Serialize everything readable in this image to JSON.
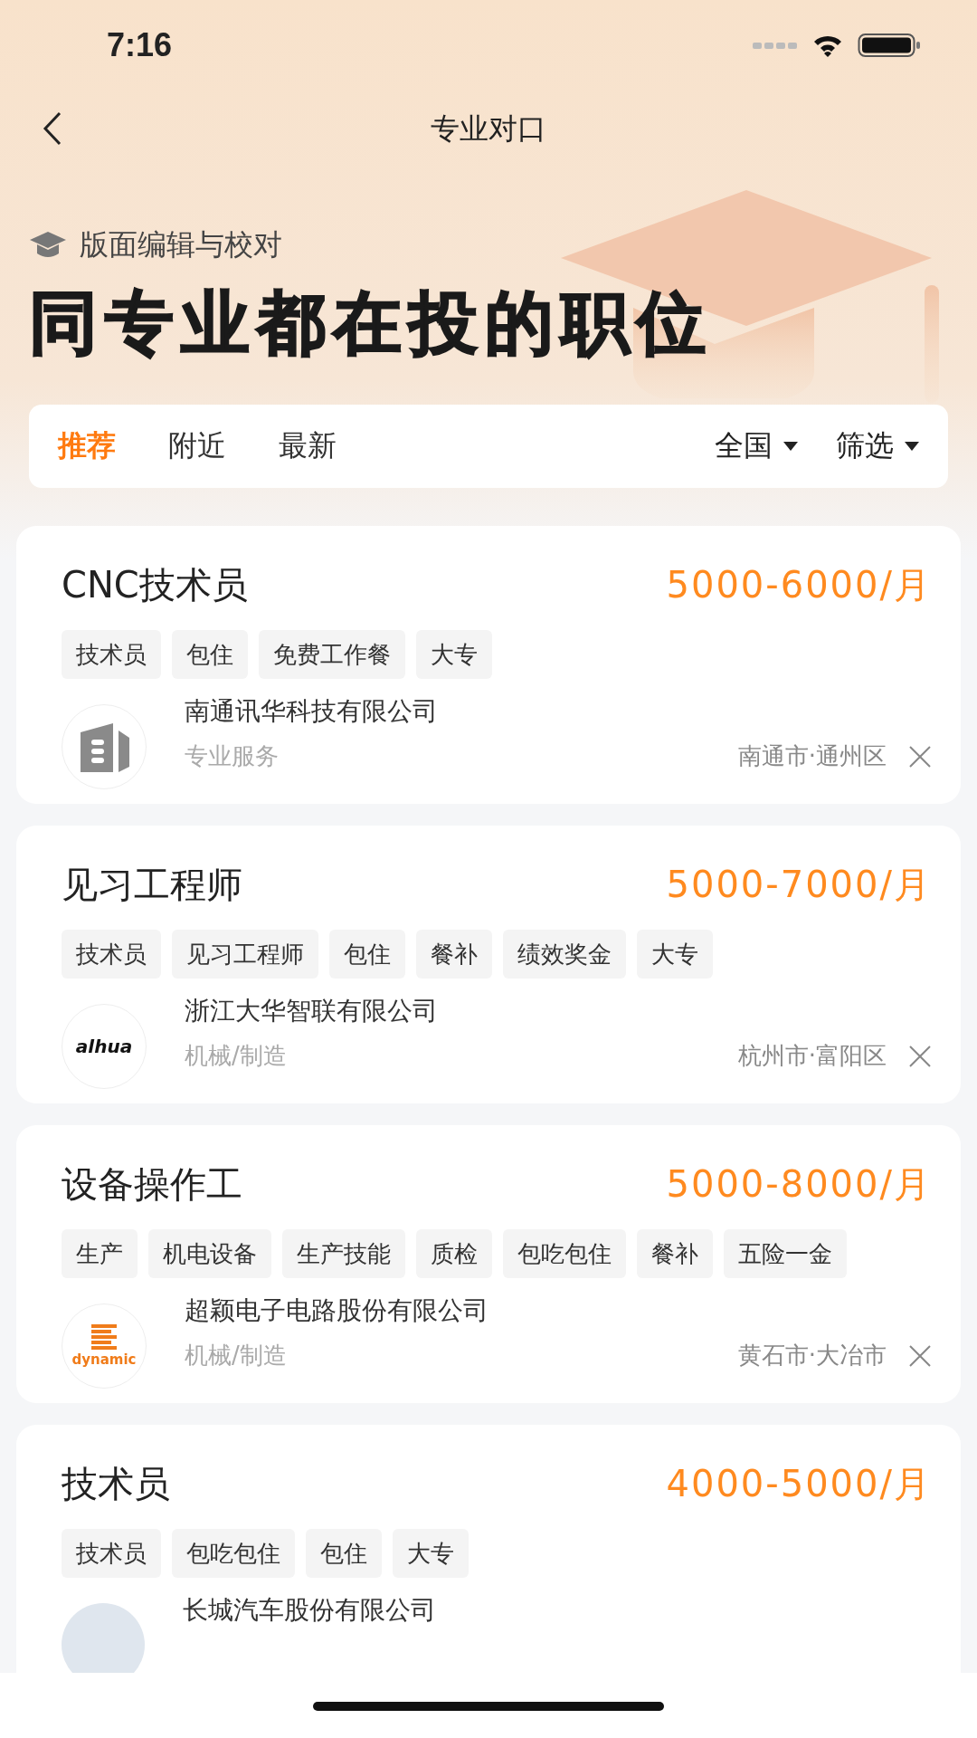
{
  "status_bar": {
    "time": "7:16"
  },
  "nav": {
    "title": "专业对口"
  },
  "header": {
    "major": "版面编辑与校对",
    "headline": "同专业都在投的职位"
  },
  "filter_bar": {
    "tabs": [
      {
        "label": "推荐",
        "selected": true
      },
      {
        "label": "附近",
        "selected": false
      },
      {
        "label": "最新",
        "selected": false
      }
    ],
    "dropdowns": [
      "全国",
      "筛选"
    ]
  },
  "jobs": [
    {
      "title": "CNC技术员",
      "salary": "5000-6000/月",
      "tags": [
        "技术员",
        "包住",
        "免费工作餐",
        "大专"
      ],
      "company": "南通讯华科技有限公司",
      "industry": "专业服务",
      "location": "南通市·通州区",
      "logo": {
        "kind": "building"
      }
    },
    {
      "title": "见习工程师",
      "salary": "5000-7000/月",
      "tags": [
        "技术员",
        "见习工程师",
        "包住",
        "餐补",
        "绩效奖金",
        "大专"
      ],
      "company": "浙江大华智联有限公司",
      "industry": "机械/制造",
      "location": "杭州市·富阳区",
      "logo": {
        "kind": "wordmark",
        "text": "alhua"
      }
    },
    {
      "title": "设备操作工",
      "salary": "5000-8000/月",
      "tags": [
        "生产",
        "机电设备",
        "生产技能",
        "质检",
        "包吃包住",
        "餐补",
        "五险一金"
      ],
      "company": "超颖电子电路股份有限公司",
      "industry": "机械/制造",
      "location": "黄石市·大冶市",
      "logo": {
        "kind": "stripes",
        "text": "dynamic"
      }
    },
    {
      "title": "技术员",
      "salary": "4000-5000/月",
      "tags": [
        "技术员",
        "包吃包住",
        "包住",
        "大专"
      ],
      "company": "长城汽车股份有限公司",
      "logo": {
        "kind": "plain"
      }
    }
  ]
}
